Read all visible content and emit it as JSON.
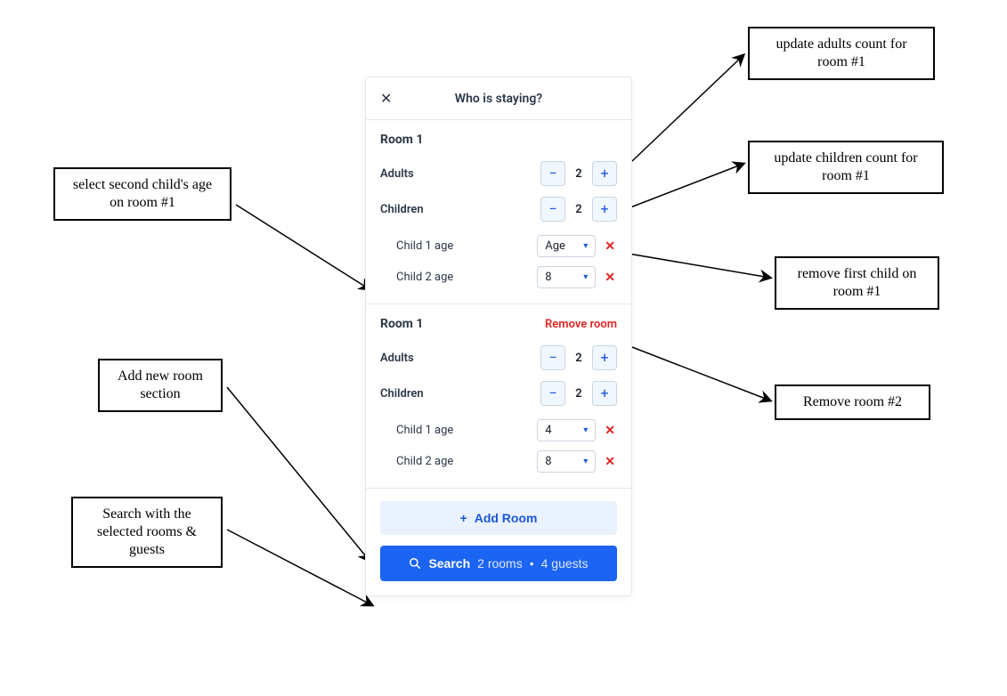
{
  "colors": {
    "accent": "#1c64f2",
    "accentLight": "#eaf2ff",
    "danger": "#e02424",
    "border": "#e2e8f0",
    "text": "#1a202c"
  },
  "callouts": {
    "left1": "select second child's age on room #1",
    "left2": "Add new room section",
    "left3": "Search with the selected rooms & guests",
    "right1": "update adults count for room #1",
    "right2": "update children count for room #1",
    "right3": "remove first child on room #1",
    "right4": "Remove room #2"
  },
  "panel": {
    "title": "Who is staying?",
    "rooms": [
      {
        "title": "Room 1",
        "remove_label": null,
        "adults_label": "Adults",
        "adults_value": "2",
        "children_label": "Children",
        "children_value": "2",
        "children": [
          {
            "label": "Child 1 age",
            "value": "Age"
          },
          {
            "label": "Child 2 age",
            "value": "8"
          }
        ]
      },
      {
        "title": "Room 1",
        "remove_label": "Remove room",
        "adults_label": "Adults",
        "adults_value": "2",
        "children_label": "Children",
        "children_value": "2",
        "children": [
          {
            "label": "Child 1 age",
            "value": "4"
          },
          {
            "label": "Child 2 age",
            "value": "8"
          }
        ]
      }
    ],
    "add_room_label": "Add Room",
    "search": {
      "prefix": "Search",
      "rooms_text": "2 rooms",
      "sep": "•",
      "guests_text": "4 guests"
    }
  }
}
